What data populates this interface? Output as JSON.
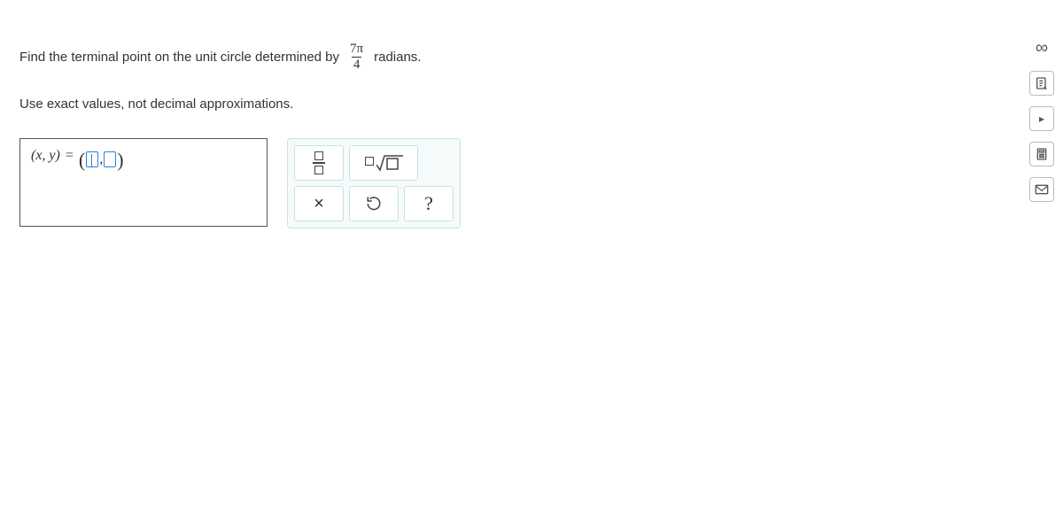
{
  "question": {
    "prefix": "Find the terminal point on the unit circle determined by",
    "fraction": {
      "num": "7π",
      "den": "4"
    },
    "suffix": "radians."
  },
  "instruction": "Use exact values, not decimal approximations.",
  "answer": {
    "lhs": "(x, y)",
    "eq": "=",
    "paren_open": "(",
    "comma": ",",
    "paren_close": ")"
  },
  "tools": {
    "fraction": "fraction",
    "sqrt": "square-root",
    "clear": "×",
    "undo": "↺",
    "help": "?"
  },
  "sidebar": {
    "infinity": "∞",
    "notes": "notes",
    "play": "▸",
    "calculator": "calculator",
    "mail": "mail"
  }
}
